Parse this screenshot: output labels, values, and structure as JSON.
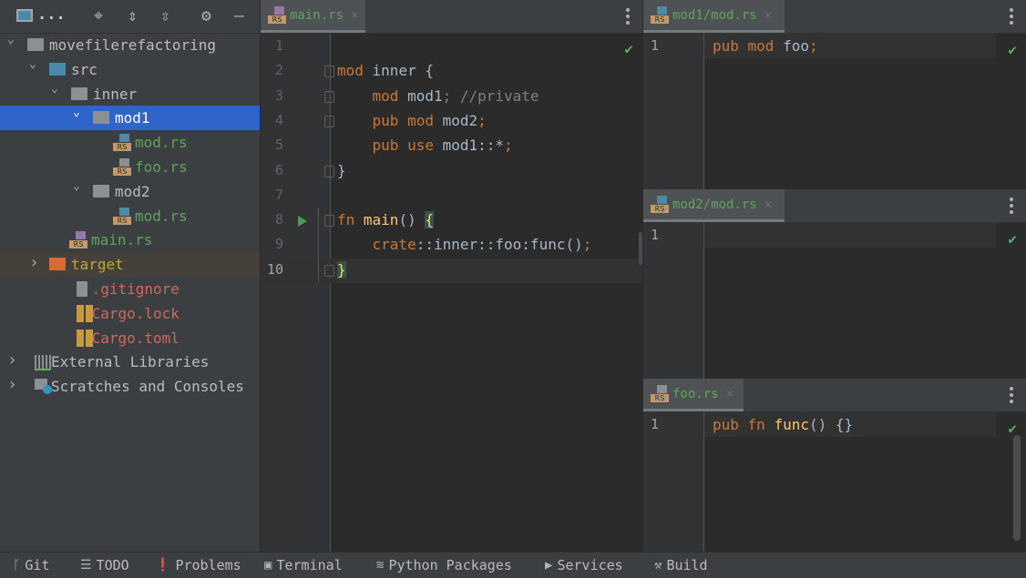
{
  "sidebar": {
    "toolbar": {
      "view_menu_label": "...",
      "icons": [
        "project-view-icon",
        "locate-icon",
        "expand-all-icon",
        "collapse-all-icon",
        "gear-icon",
        "minimize-icon"
      ]
    },
    "tree": [
      {
        "label": "movefilerefactoring",
        "type": "folder",
        "expanded": true,
        "color": "#bbbbbb"
      },
      {
        "label": "src",
        "type": "source-folder",
        "expanded": true,
        "color": "#bbbbbb"
      },
      {
        "label": "inner",
        "type": "folder",
        "expanded": true,
        "color": "#bbbbbb"
      },
      {
        "label": "mod1",
        "type": "folder",
        "expanded": true,
        "selected": true,
        "color": "#ffffff"
      },
      {
        "label": "mod.rs",
        "type": "rust-file",
        "color": "#62a35c"
      },
      {
        "label": "foo.rs",
        "type": "rust-file",
        "color": "#62a35c"
      },
      {
        "label": "mod2",
        "type": "folder",
        "expanded": true,
        "color": "#bbbbbb"
      },
      {
        "label": "mod.rs",
        "type": "rust-file",
        "color": "#62a35c"
      },
      {
        "label": "main.rs",
        "type": "rust-file",
        "color": "#62a35c"
      },
      {
        "label": "target",
        "type": "excluded-folder",
        "expanded": false,
        "color": "#b8a93b"
      },
      {
        "label": ".gitignore",
        "type": "ignore-file",
        "color": "#d1675a"
      },
      {
        "label": "Cargo.lock",
        "type": "lock-file",
        "color": "#d1675a"
      },
      {
        "label": "Cargo.toml",
        "type": "toml-file",
        "color": "#d1675a"
      },
      {
        "label": "External Libraries",
        "type": "libraries",
        "expanded": false,
        "color": "#bbbbbb"
      },
      {
        "label": "Scratches and Consoles",
        "type": "scratches",
        "expanded": false,
        "color": "#bbbbbb"
      }
    ]
  },
  "main_editor": {
    "tab": {
      "label": "main.rs",
      "close": "×"
    },
    "inspection_status": "ok",
    "line_numbers": [
      "1",
      "2",
      "3",
      "4",
      "5",
      "6",
      "7",
      "8",
      "9",
      "10"
    ],
    "current_line": "10",
    "lines": [
      [],
      [
        {
          "t": "mod",
          "c": "kw"
        },
        {
          "t": " inner {",
          "c": ""
        }
      ],
      [
        {
          "t": "    mod",
          "c": "kw"
        },
        {
          "t": " mod1",
          "c": ""
        },
        {
          "t": ";",
          "c": "kw"
        },
        {
          "t": " //private",
          "c": "cm"
        }
      ],
      [
        {
          "t": "    pub mod",
          "c": "kw"
        },
        {
          "t": " mod2",
          "c": ""
        },
        {
          "t": ";",
          "c": "kw"
        }
      ],
      [
        {
          "t": "    pub use",
          "c": "kw"
        },
        {
          "t": " mod1::*",
          "c": ""
        },
        {
          "t": ";",
          "c": "kw"
        }
      ],
      [
        {
          "t": "}",
          "c": ""
        }
      ],
      [],
      [
        {
          "t": "fn",
          "c": "kw"
        },
        {
          "t": " ",
          "c": ""
        },
        {
          "t": "main",
          "c": "fn"
        },
        {
          "t": "() ",
          "c": ""
        },
        {
          "t": "{",
          "c": "br"
        }
      ],
      [
        {
          "t": "    crate",
          "c": "kw"
        },
        {
          "t": "::inner::foo:func()",
          "c": ""
        },
        {
          "t": ";",
          "c": "kw"
        }
      ],
      [
        {
          "t": "}",
          "c": "br"
        }
      ]
    ]
  },
  "right_editors": [
    {
      "tab": {
        "label": "mod1/mod.rs",
        "close": "×"
      },
      "line_numbers": [
        "1"
      ],
      "lines": [
        [
          {
            "t": "pub mod",
            "c": "kw"
          },
          {
            "t": " foo",
            "c": ""
          },
          {
            "t": ";",
            "c": "kw"
          }
        ]
      ]
    },
    {
      "tab": {
        "label": "mod2/mod.rs",
        "close": "×"
      },
      "line_numbers": [
        "1"
      ],
      "lines": [
        []
      ]
    },
    {
      "tab": {
        "label": "foo.rs",
        "close": "×"
      },
      "line_numbers": [
        "1"
      ],
      "lines": [
        [
          {
            "t": "pub fn",
            "c": "kw"
          },
          {
            "t": " ",
            "c": ""
          },
          {
            "t": "func",
            "c": "fn"
          },
          {
            "t": "() {}",
            "c": ""
          }
        ]
      ]
    }
  ],
  "statusbar": {
    "items": [
      {
        "label": "Git",
        "icon": "git-branch-icon"
      },
      {
        "label": "TODO",
        "icon": "todo-list-icon"
      },
      {
        "label": "Problems",
        "icon": "problems-icon"
      },
      {
        "label": "Terminal",
        "icon": "terminal-icon"
      },
      {
        "label": "Python Packages",
        "icon": "python-packages-icon"
      },
      {
        "label": "Services",
        "icon": "services-icon"
      },
      {
        "label": "Build",
        "icon": "build-hammer-icon"
      }
    ]
  },
  "colors": {
    "selection": "#2f65ca",
    "keyword": "#cc7832",
    "function": "#ffc66d",
    "file_name_modified": "#62a35c",
    "file_name_untracked": "#d1675a",
    "check": "#59a869"
  }
}
